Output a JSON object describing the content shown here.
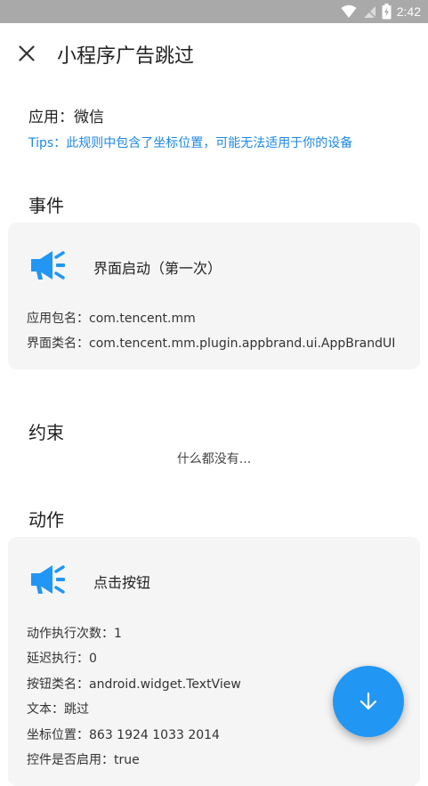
{
  "status_bar": {
    "time": "2:42"
  },
  "header": {
    "title": "小程序广告跳过"
  },
  "app": {
    "label": "应用：微信"
  },
  "tips": "Tips：此规则中包含了坐标位置，可能无法适用于你的设备",
  "event": {
    "section_title": "事件",
    "title": "界面启动（第一次）",
    "package": "应用包名：com.tencent.mm",
    "activity": "界面类名：com.tencent.mm.plugin.appbrand.ui.AppBrandUI"
  },
  "constraint": {
    "section_title": "约束",
    "empty": "什么都没有..."
  },
  "action": {
    "section_title": "动作",
    "title": "点击按钮",
    "details": [
      "动作执行次数：1",
      "延迟执行：0",
      "按钮类名：android.widget.TextView",
      "文本：跳过",
      "坐标位置：863 1924 1033 2014",
      "控件是否启用：true"
    ]
  },
  "colors": {
    "accent": "#2196f3",
    "tips": "#1e88e5",
    "card": "#f5f5f5"
  }
}
